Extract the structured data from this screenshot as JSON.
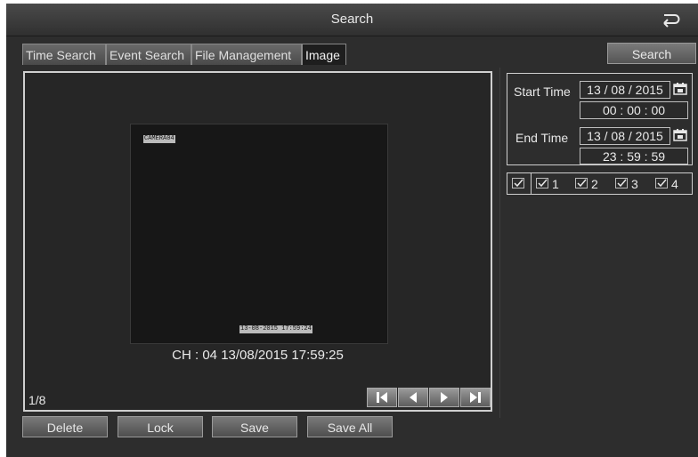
{
  "window": {
    "title": "Search"
  },
  "tabs": [
    {
      "label": "Time Search",
      "active": false
    },
    {
      "label": "Event Search",
      "active": false
    },
    {
      "label": "File Management",
      "active": false
    },
    {
      "label": "Image",
      "active": true
    }
  ],
  "search_button": "Search",
  "viewer": {
    "overlay_camera": "CAMERA04",
    "overlay_timestamp": "13-08-2015 17:59:24",
    "info": "CH : 04  13/08/2015 17:59:25",
    "page": "1/8",
    "nav_icons": [
      "skip-first-icon",
      "previous-icon",
      "next-icon",
      "skip-last-icon"
    ]
  },
  "buttons": {
    "delete": "Delete",
    "lock": "Lock",
    "save": "Save",
    "save_all": "Save All"
  },
  "time": {
    "start_label": "Start Time",
    "start_date": "13 / 08 / 2015",
    "start_time": "00 : 00 : 00",
    "end_label": "End Time",
    "end_date": "13 / 08 / 2015",
    "end_time": "23 : 59 : 59"
  },
  "channels": [
    "1",
    "2",
    "3",
    "4"
  ],
  "colors": {
    "background": "#2d2d2d",
    "border": "#cfcfcf",
    "text": "#e8e8e8"
  }
}
